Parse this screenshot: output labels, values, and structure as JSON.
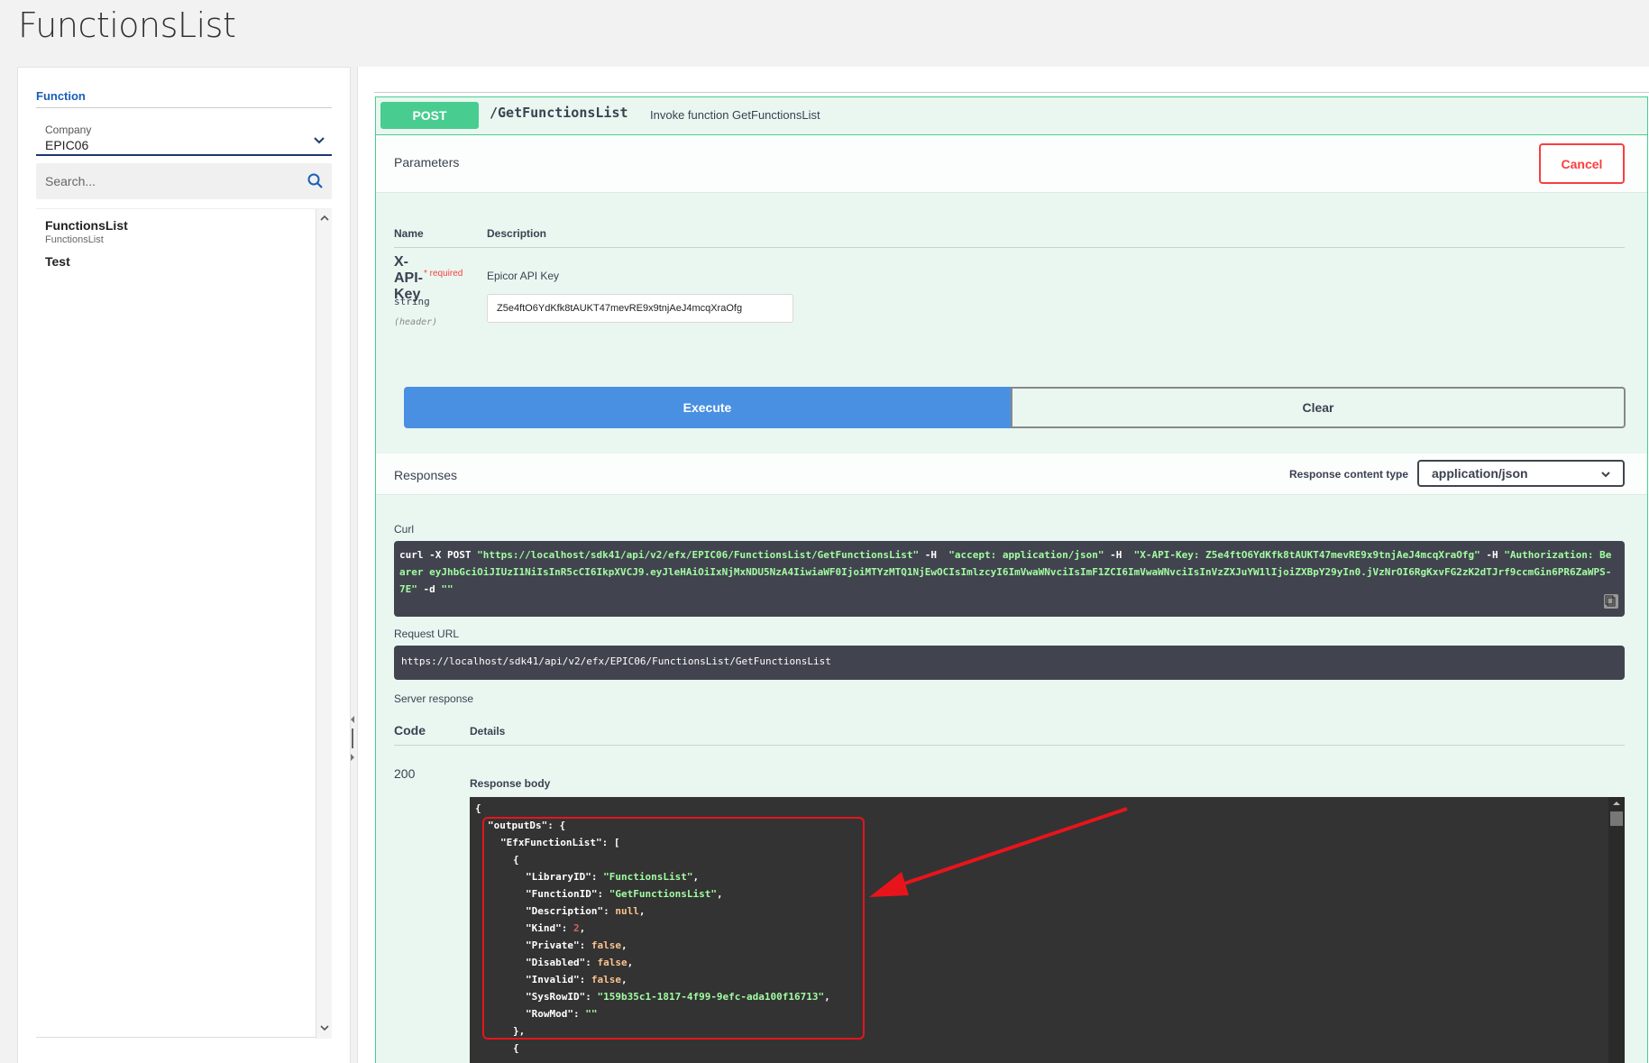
{
  "page": {
    "title": "FunctionsList"
  },
  "left_panel": {
    "tab_label": "Function",
    "company": {
      "label": "Company",
      "value": "EPIC06"
    },
    "search": {
      "placeholder": "Search..."
    },
    "items": [
      {
        "title": "FunctionsList",
        "subtitle": "FunctionsList"
      },
      {
        "title": "Test"
      }
    ]
  },
  "operation": {
    "method": "POST",
    "path": "/GetFunctionsList",
    "summary": "Invoke function GetFunctionsList",
    "parameters_title": "Parameters",
    "cancel_label": "Cancel",
    "columns": {
      "name": "Name",
      "description": "Description"
    },
    "param": {
      "name": "X-API-Key",
      "required": "* required",
      "type": "string",
      "in": "(header)",
      "description": "Epicor API Key",
      "value": "Z5e4ftO6YdKfk8tAUKT47mevRE9x9tnjAeJ4mcqXraOfg"
    },
    "execute_label": "Execute",
    "clear_label": "Clear",
    "responses_title": "Responses",
    "response_content_type_label": "Response content type",
    "response_content_type": "application/json",
    "curl_label": "Curl",
    "curl": {
      "part1": "curl -X POST ",
      "url": "\"https://localhost/sdk41/api/v2/efx/EPIC06/FunctionsList/GetFunctionsList\"",
      "part2": " -H  ",
      "accept": "\"accept: application/json\"",
      "part3": " -H  ",
      "apikey": "\"X-API-Key: Z5e4ftO6YdKfk8tAUKT47mevRE9x9tnjAeJ4mcqXraOfg\"",
      "part4": " -H ",
      "auth": "\"Authorization: Bearer eyJhbGciOiJIUzI1NiIsInR5cCI6IkpXVCJ9.eyJleHAiOiIxNjMxNDU5NzA4IiwiaWF0IjoiMTYzMTQ1NjEwOCIsImlzcyI6ImVwaWNvciIsImF1ZCI6ImVwaWNvciIsInVzZXJuYW1lIjoiZXBpY29yIn0.jVzNrOI6RgKxvFG2zK2dTJrf9ccmGin6PR6ZaWPS-7E\"",
      "part5": " -d ",
      "data": "\"\""
    },
    "request_url_label": "Request URL",
    "request_url": "https://localhost/sdk41/api/v2/efx/EPIC06/FunctionsList/GetFunctionsList",
    "server_response_label": "Server response",
    "code_label": "Code",
    "details_label": "Details",
    "status_code": "200",
    "response_body_label": "Response body",
    "response_body": {
      "l0": "{",
      "k_outputDs": "\"outputDs\"",
      "p_outputDs": ": {",
      "k_list": "\"EfxFunctionList\"",
      "p_list": ": [",
      "open_obj": "{",
      "k_lib": "\"LibraryID\"",
      "v_lib": "\"FunctionsList\"",
      "k_fn": "\"FunctionID\"",
      "v_fn": "\"GetFunctionsList\"",
      "k_desc": "\"Description\"",
      "v_desc": "null",
      "k_kind": "\"Kind\"",
      "v_kind": "2",
      "k_priv": "\"Private\"",
      "v_priv": "false",
      "k_dis": "\"Disabled\"",
      "v_dis": "false",
      "k_inv": "\"Invalid\"",
      "v_inv": "false",
      "k_sys": "\"SysRowID\"",
      "v_sys": "\"159b35c1-1817-4f99-9efc-ada100f16713\"",
      "k_row": "\"RowMod\"",
      "v_row": "\"\"",
      "close_obj": "},",
      "open_obj2": "{"
    }
  },
  "colors": {
    "post_green": "#49cc90",
    "execute_blue": "#4990e2",
    "cancel_red": "#f93e3e",
    "highlight_red": "#e8141c",
    "code_bg": "#41444e"
  }
}
